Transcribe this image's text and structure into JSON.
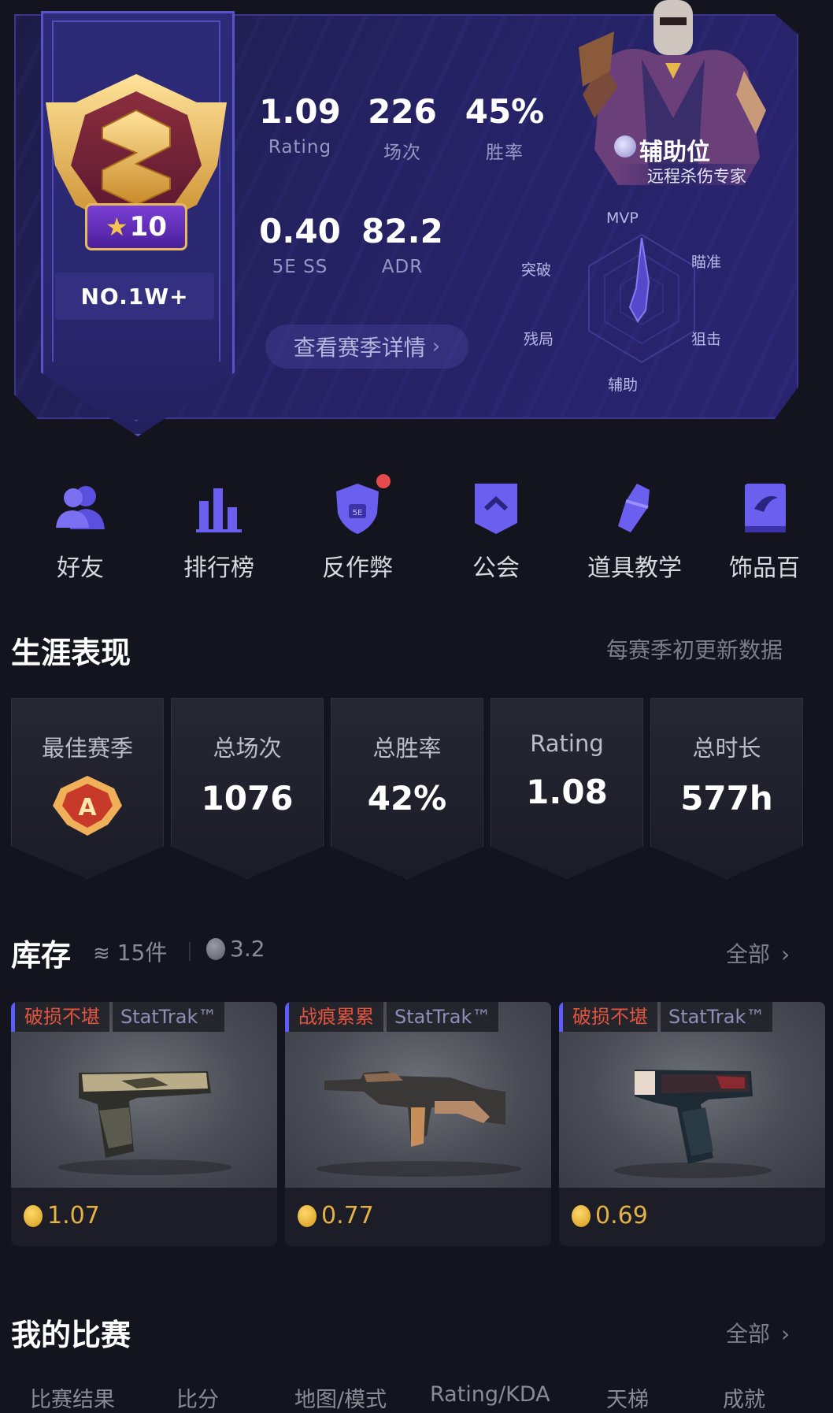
{
  "season": {
    "rank_level": "10",
    "rank_position": "NO.1W+",
    "stats": [
      {
        "value": "1.09",
        "label": "Rating"
      },
      {
        "value": "226",
        "label": "场次"
      },
      {
        "value": "45%",
        "label": "胜率"
      },
      {
        "value": "0.40",
        "label": "5E SS"
      },
      {
        "value": "82.2",
        "label": "ADR"
      }
    ],
    "detail_link": "查看赛季详情",
    "role": {
      "title": "辅助位",
      "subtitle": "远程杀伤专家"
    },
    "radar_labels": {
      "top": "MVP",
      "top_right": "瞄准",
      "bottom_right": "狙击",
      "bottom": "辅助",
      "bottom_left": "残局",
      "top_left": "突破"
    }
  },
  "menu": [
    {
      "label": "好友",
      "icon": "friends-icon"
    },
    {
      "label": "排行榜",
      "icon": "leaderboard-icon"
    },
    {
      "label": "反作弊",
      "icon": "anticheat-shield-icon"
    },
    {
      "label": "公会",
      "icon": "guild-icon"
    },
    {
      "label": "道具教学",
      "icon": "grenade-icon"
    },
    {
      "label": "饰品百",
      "icon": "knife-book-icon"
    }
  ],
  "career": {
    "title": "生涯表现",
    "note": "每赛季初更新数据",
    "cards": [
      {
        "label": "最佳赛季",
        "value": ""
      },
      {
        "label": "总场次",
        "value": "1076"
      },
      {
        "label": "总胜率",
        "value": "42%"
      },
      {
        "label": "Rating",
        "value": "1.08"
      },
      {
        "label": "总时长",
        "value": "577h"
      }
    ]
  },
  "inventory": {
    "title": "库存",
    "count": "15件",
    "value": "3.2",
    "see_all": "全部",
    "items": [
      {
        "wear": "破损不堪",
        "stattrak": "StatTrak™",
        "price": "1.07"
      },
      {
        "wear": "战痕累累",
        "stattrak": "StatTrak™",
        "price": "0.77"
      },
      {
        "wear": "破损不堪",
        "stattrak": "StatTrak™",
        "price": "0.69"
      }
    ]
  },
  "matches": {
    "title": "我的比赛",
    "see_all": "全部",
    "columns": [
      "比赛结果",
      "比分",
      "地图/模式",
      "Rating/KDA",
      "天梯",
      "成就"
    ]
  },
  "colors": {
    "accent": "#5b5bff",
    "purple_bg": "#252263",
    "gold": "#e3b144",
    "wear_red": "#e2543e",
    "page_bg": "#13141d"
  }
}
